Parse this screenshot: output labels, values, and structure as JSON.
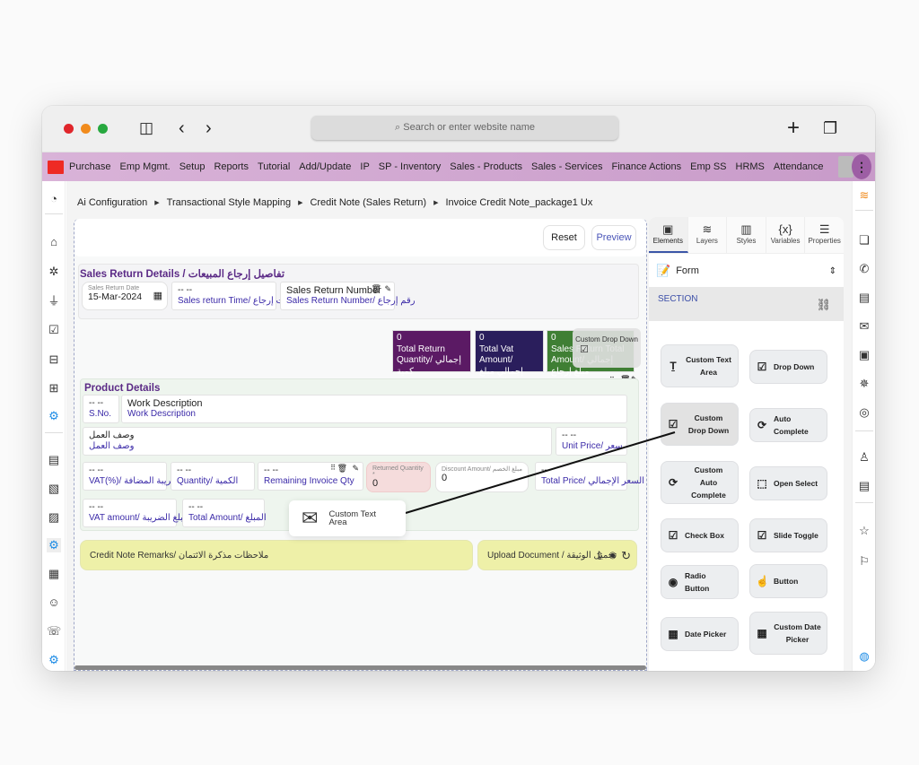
{
  "browser": {
    "url_placeholder": "Search or enter website name",
    "icons": [
      "sidebar-toggle-icon",
      "back-icon",
      "forward-icon",
      "new-tab-icon",
      "tabs-overview-icon"
    ]
  },
  "menubar": {
    "items": [
      "Purchase",
      "Emp Mgmt.",
      "Setup",
      "Reports",
      "Tutorial",
      "Add/Update",
      "IP",
      "SP - Inventory",
      "Sales - Products",
      "Sales - Services",
      "Finance Actions",
      "Emp SS",
      "HRMS",
      "Attendance"
    ],
    "kebab": "⋮"
  },
  "breadcrumb": {
    "items": [
      "Ai Configuration",
      "Transactional Style Mapping",
      "Credit Note (Sales Return)",
      "Invoice Credit Note_package1 Ux"
    ]
  },
  "toolbar": {
    "reset_label": "Reset",
    "preview_label": "Preview"
  },
  "sales_return": {
    "title": "Sales Return Details / تفاصيل إرجاع المبيعات",
    "date_label": "Sales Return Date",
    "date_value": "15-Mar-2024",
    "time_value": "-- --",
    "time_label": "Sales return Time/ وقت إرجاع",
    "number_value": "Sales Return Number",
    "number_label": "Sales Return Number/ رقم إرجاع"
  },
  "totals": [
    {
      "value": "0",
      "label1": "Total Return",
      "label2": "Quantity/ إجمالي كمية",
      "color": "#5b1a64"
    },
    {
      "value": "0",
      "label1": "Total Vat Amount/",
      "label2": "إجمالي مبلغ الضريبة",
      "color": "#2a1e5c"
    },
    {
      "value": "0",
      "label1": "Sales Return Total",
      "label2": "Amount/ إجمالي مبلغ إرجاع",
      "color": "#3f7f34"
    }
  ],
  "product": {
    "title": "Product Details",
    "sno_value": "-- --",
    "sno_label": "S.No.",
    "work_value": "Work Description",
    "work_label": "Work Description",
    "work_ar_value": "وصف العمل",
    "work_ar_label": "وصف العمل",
    "unit_price_value": "-- --",
    "unit_price_label": "Unit Price/ سعر",
    "vat_pct_value": "-- --",
    "vat_pct_label": "VAT(%)/ الضريبة المضافة",
    "qty_value": "-- --",
    "qty_label": "Quantity/ الكمية",
    "remaining_value": "-- --",
    "remaining_label": "Remaining Invoice Qty",
    "returned_label": "Returned Quantity *",
    "returned_value": "0",
    "discount_label": "Discount Amount/ مبلغ الخصم",
    "discount_value": "0",
    "total_price_value": "--",
    "total_price_label": "Total Price/ السعر الإجمالي",
    "vat_amount_value": "-- --",
    "vat_amount_label": "VAT amount/ مبلغ الضريبة",
    "total_amount_value": "-- --",
    "total_amount_label": "Total Amount/ المبلغ"
  },
  "remarks": {
    "label": "Credit Note Remarks/ ملاحظات مذكرة الائتمان"
  },
  "upload": {
    "label": "Upload Document / تحميل الوثيقة"
  },
  "panel": {
    "tabs": [
      {
        "label": "Elements",
        "icon": "▣"
      },
      {
        "label": "Layers",
        "icon": "≋"
      },
      {
        "label": "Styles",
        "icon": "▥"
      },
      {
        "label": "Variables",
        "icon": "{x}"
      },
      {
        "label": "Properties",
        "icon": "☰"
      }
    ],
    "form_label": "Form",
    "section_label": "SECTION",
    "elements": [
      {
        "label": "Custom Text Area",
        "icon": "Ṯ"
      },
      {
        "label": "Drop Down",
        "icon": "☑"
      },
      {
        "label": "Custom Drop Down",
        "icon": "☑"
      },
      {
        "label": "Auto Complete",
        "icon": "⟳"
      },
      {
        "label": "Custom Auto Complete",
        "icon": "⟳"
      },
      {
        "label": "Open Select",
        "icon": "⬚"
      },
      {
        "label": "Check Box",
        "icon": "☑"
      },
      {
        "label": "Slide Toggle",
        "icon": "☑"
      },
      {
        "label": "Radio Button",
        "icon": "◉"
      },
      {
        "label": "Button",
        "icon": "☝"
      },
      {
        "label": "Date Picker",
        "icon": "▦"
      },
      {
        "label": "Custom Date Picker",
        "icon": "▦"
      }
    ]
  },
  "drag_ghost": {
    "label": "Custom Drop Down"
  },
  "floating_item": {
    "label": "Custom Text Area"
  }
}
